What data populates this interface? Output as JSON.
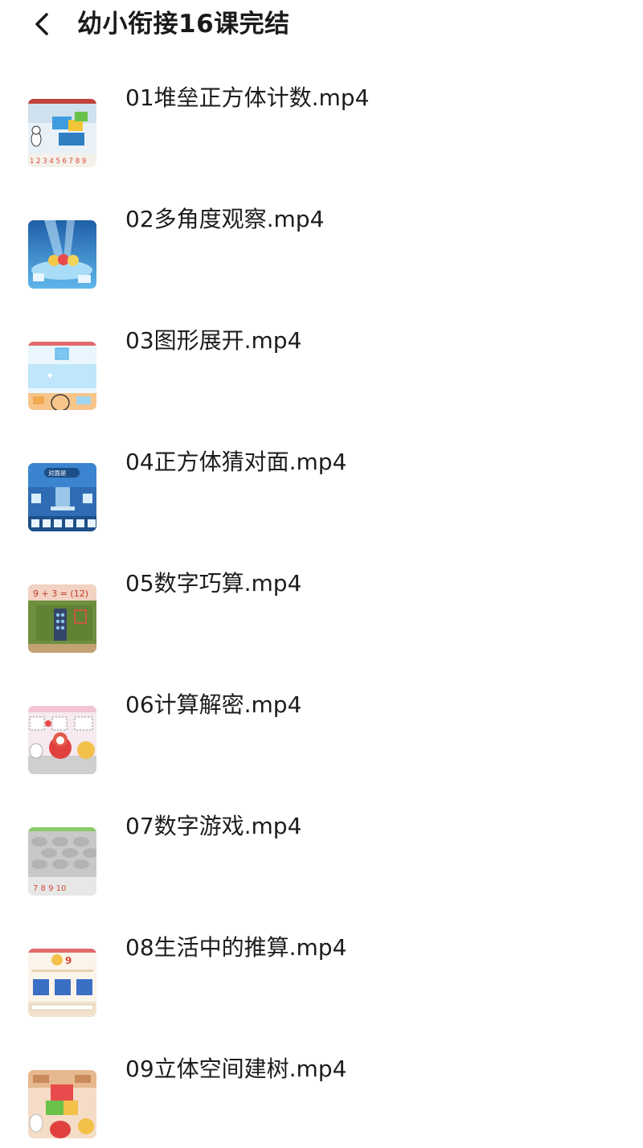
{
  "header": {
    "back_icon": "chevron-left-icon",
    "title": "幼小衔接16课完结"
  },
  "files": [
    {
      "name": "01堆垒正方体计数.mp4",
      "thumb_numbers": "1 2 3 4 5 6 7 8 9"
    },
    {
      "name": "02多角度观察.mp4"
    },
    {
      "name": "03图形展开.mp4"
    },
    {
      "name": "04正方体猜对面.mp4",
      "thumb_label": "对面是"
    },
    {
      "name": "05数字巧算.mp4",
      "thumb_equation": "9 + 3 = (12)"
    },
    {
      "name": "06计算解密.mp4"
    },
    {
      "name": "07数字游戏.mp4",
      "thumb_numbers": "7  8  9  10"
    },
    {
      "name": "08生活中的推算.mp4",
      "thumb_number": "9"
    },
    {
      "name": "09立体空间建树.mp4"
    }
  ]
}
